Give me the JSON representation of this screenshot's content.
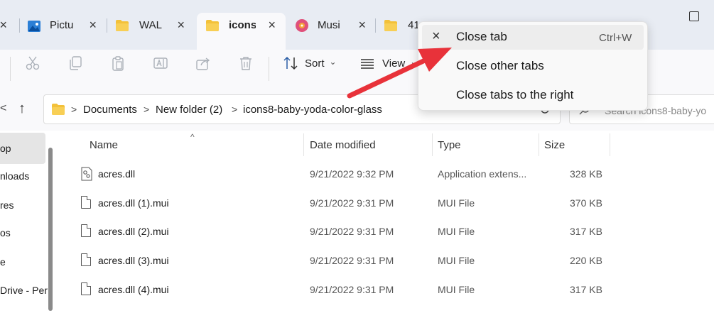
{
  "tabs": [
    {
      "label": "Pictu",
      "icon": "image-icon"
    },
    {
      "label": "WAL",
      "icon": "folder-icon"
    },
    {
      "label": "icons",
      "icon": "folder-icon",
      "active": true
    },
    {
      "label": "Musi",
      "icon": "music-icon"
    },
    {
      "label": "41",
      "icon": "folder-icon"
    }
  ],
  "tab_close_glyph": "×",
  "toolbar": {
    "sort_label": "Sort",
    "view_label": "View",
    "dropdown_glyph": "⌄"
  },
  "nav": {
    "left_glyph": "<",
    "up_glyph": "↑",
    "breadcrumb": [
      "Documents",
      "New folder (2)",
      "icons8-baby-yoda-color-glass"
    ],
    "chevron_glyph": ">",
    "search_placeholder": "Search icons8-baby-yo"
  },
  "sidebar": {
    "items": [
      "op",
      "nloads",
      "res",
      "os",
      "e",
      "Drive - Per"
    ]
  },
  "columns": {
    "name": "Name",
    "date": "Date modified",
    "type": "Type",
    "size": "Size",
    "sort_glyph": "^"
  },
  "files": [
    {
      "name": "acres.dll",
      "date": "9/21/2022 9:32 PM",
      "type": "Application extens...",
      "size": "328 KB",
      "icon": "dll-gear-icon"
    },
    {
      "name": "acres.dll (1).mui",
      "date": "9/21/2022 9:31 PM",
      "type": "MUI File",
      "size": "370 KB",
      "icon": "file-icon"
    },
    {
      "name": "acres.dll (2).mui",
      "date": "9/21/2022 9:31 PM",
      "type": "MUI File",
      "size": "317 KB",
      "icon": "file-icon"
    },
    {
      "name": "acres.dll (3).mui",
      "date": "9/21/2022 9:31 PM",
      "type": "MUI File",
      "size": "220 KB",
      "icon": "file-icon"
    },
    {
      "name": "acres.dll (4).mui",
      "date": "9/21/2022 9:31 PM",
      "type": "MUI File",
      "size": "317 KB",
      "icon": "file-icon"
    }
  ],
  "context_menu": {
    "items": [
      {
        "label": "Close tab",
        "shortcut": "Ctrl+W",
        "icon": "close-icon"
      },
      {
        "label": "Close other tabs"
      },
      {
        "label": "Close tabs to the right"
      }
    ],
    "close_glyph": "×"
  },
  "colors": {
    "arrow": "#e8323a",
    "tab_bar": "#e8ecf3",
    "folder": "#f3c13a"
  }
}
